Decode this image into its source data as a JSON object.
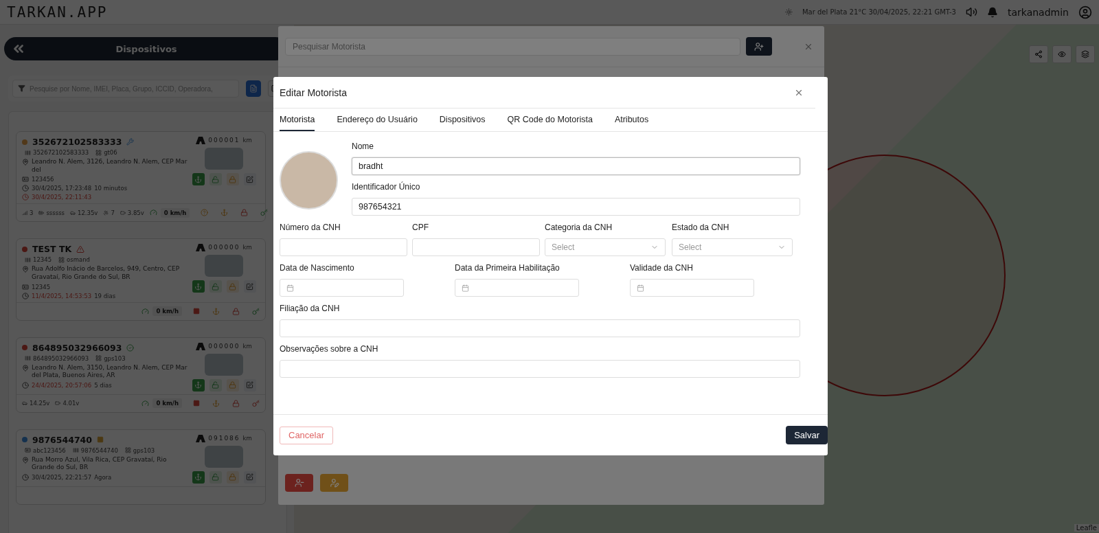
{
  "top_bar": {
    "logo": "TARKAN.APP",
    "weather": "Mar del Plata 21°C  30/04/2025, 22:21 GMT-3",
    "username": "tarkanadmin"
  },
  "sidebar": {
    "title": "Dispositivos",
    "search": {
      "placeholder": "Pesquise por Nome, IMEI, Placa, Grupo, ICCID, Operadora,"
    },
    "devices": [
      {
        "name": "352672102583333",
        "status": {
          "kind": "idle"
        },
        "badge": {
          "kind": "tool"
        },
        "odometer": "000001",
        "unit": "km",
        "tags": [
          {
            "kind": "imei",
            "text": "352672102583333"
          },
          {
            "kind": "protocol",
            "text": "gt06"
          }
        ],
        "address": "Leandro N. Alem, 3126, Leandro N. Alem, CEP Mar del",
        "plate": "123456",
        "time": "30/4/2025, 17:23:48",
        "late": false,
        "ago": "10 minutos",
        "alert_time": "30/4/2025, 22:11:43",
        "stats": [
          {
            "kind": "signal",
            "text": "3"
          },
          {
            "kind": "battery",
            "text": "ssssss"
          },
          {
            "kind": "car-battery",
            "text": "12.35v"
          },
          {
            "kind": "satellite",
            "text": "7"
          },
          {
            "kind": "cell",
            "text": "3.85v"
          }
        ],
        "speed": "0 km/h",
        "footer_icons": [
          {
            "kind": "help"
          },
          {
            "kind": "anchor"
          },
          {
            "kind": "lock"
          },
          {
            "kind": "key-green"
          }
        ]
      },
      {
        "name": "TEST TK",
        "status": {
          "kind": "offline"
        },
        "badge": {
          "kind": "warning"
        },
        "odometer": "000000",
        "unit": "km",
        "tags": [
          {
            "kind": "imei",
            "text": "12345"
          },
          {
            "kind": "protocol",
            "text": "osmand"
          }
        ],
        "address": "Rua Adolfo Inácio de Barcelos, 949, Centro, CEP Gravataí, Rio Grande do Sul, BR",
        "plate": "12345",
        "time": "11/4/2025, 14:53:53",
        "late": true,
        "ago": "19 dias",
        "speed": "0 km/h",
        "footer_icons": [
          {
            "kind": "stop"
          },
          {
            "kind": "anchor"
          },
          {
            "kind": "lock"
          },
          {
            "kind": "key-green"
          }
        ]
      },
      {
        "name": "864895032966093",
        "status": {
          "kind": "offline"
        },
        "badge": {
          "kind": "check"
        },
        "odometer": "000000",
        "unit": "km",
        "tags": [
          {
            "kind": "imei",
            "text": "864895032966093"
          },
          {
            "kind": "protocol",
            "text": "gps103"
          }
        ],
        "address": "Leandro N. Alem, 3150, Leandro N. Alem, CEP Mar del Plata, Buenos Aires, AR",
        "time": "24/4/2025, 20:57:06",
        "late": true,
        "ago": "5 dias",
        "stats": [
          {
            "kind": "car-battery",
            "text": "14.25v"
          },
          {
            "kind": "cell",
            "text": "4.01v"
          }
        ],
        "speed": "0 km/h",
        "footer_icons": [
          {
            "kind": "stop"
          },
          {
            "kind": "anchor"
          },
          {
            "kind": "lock"
          },
          {
            "kind": "key-red"
          }
        ]
      },
      {
        "name": "9876544740",
        "status": {
          "kind": "online"
        },
        "badge": {
          "kind": "square"
        },
        "odometer": "091086",
        "unit": "km",
        "tags": [
          {
            "kind": "plate",
            "text": "abc123456"
          },
          {
            "kind": "imei",
            "text": "9876544740"
          },
          {
            "kind": "protocol",
            "text": "gps103"
          }
        ],
        "address": "Rua Morro Azul, Vila Rica, CEP Gravataí, Rio Grande do Sul, BR",
        "time": "30/4/2025, 22:21:57",
        "late": false,
        "ago": "Agora"
      }
    ]
  },
  "map": {
    "attribution": "Leafle"
  },
  "driver_list_modal": {
    "search": {
      "placeholder": "Pesquisar Motorista"
    }
  },
  "edit_modal": {
    "title": "Editar Motorista",
    "tabs": [
      {
        "label": "Motorista",
        "selected": true
      },
      {
        "label": "Endereço do Usuário",
        "selected": false
      },
      {
        "label": "Dispositivos",
        "selected": false
      },
      {
        "label": "QR Code do Motorista",
        "selected": false
      },
      {
        "label": "Atributos",
        "selected": false
      }
    ],
    "top_fields": [
      {
        "label": "Nome",
        "value": "bradht"
      },
      {
        "label": "Identificador Único",
        "value": "987654321"
      }
    ],
    "row_fields": [
      {
        "kind": "text",
        "label": "Número da CNH"
      },
      {
        "kind": "text",
        "label": "CPF"
      },
      {
        "kind": "select",
        "label": "Categoria da CNH",
        "placeholder": "Select"
      },
      {
        "kind": "select",
        "label": "Estado da CNH",
        "placeholder": "Select"
      }
    ],
    "date_fields": [
      {
        "kind": "date",
        "label": "Data de Nascimento"
      },
      {
        "kind": "date",
        "label": "Data da Primeira Habilitação"
      },
      {
        "kind": "date",
        "label": "Validade da CNH"
      }
    ],
    "wide_fields": [
      {
        "label": "Filiação da CNH"
      },
      {
        "label": "Observações sobre a CNH"
      }
    ],
    "cancel": "Cancelar",
    "save": "Salvar"
  }
}
